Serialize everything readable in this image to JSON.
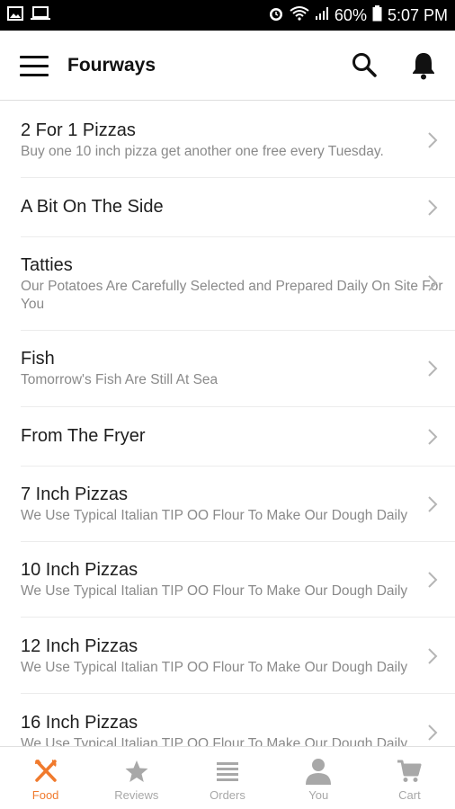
{
  "status_bar": {
    "battery": "60%",
    "time": "5:07 PM",
    "icons": [
      "image-icon",
      "laptop-icon",
      "alarm-icon",
      "wifi-icon",
      "signal-icon",
      "battery-icon"
    ]
  },
  "app_bar": {
    "title": "Fourways",
    "icons": [
      "menu-icon",
      "search-icon",
      "bell-icon"
    ]
  },
  "categories": [
    {
      "title": "2 For 1 Pizzas",
      "description": "Buy one 10 inch pizza get another one free every Tuesday."
    },
    {
      "title": "A Bit On The Side",
      "description": ""
    },
    {
      "title": "Tatties",
      "description": "Our Potatoes Are Carefully Selected and Prepared Daily On Site For You"
    },
    {
      "title": "Fish",
      "description": "Tomorrow's Fish Are Still At Sea"
    },
    {
      "title": "From The Fryer",
      "description": ""
    },
    {
      "title": "7 Inch Pizzas",
      "description": "We Use Typical Italian TIP OO Flour To Make Our Dough Daily"
    },
    {
      "title": "10 Inch Pizzas",
      "description": "We Use Typical Italian TIP OO Flour To Make Our Dough Daily"
    },
    {
      "title": "12 Inch Pizzas",
      "description": "We Use Typical Italian TIP OO Flour To Make Our Dough Daily"
    },
    {
      "title": "16 Inch Pizzas",
      "description": "We Use Typical Italian TIP OO Flour To Make Our Dough Daily"
    }
  ],
  "bottom_nav": [
    {
      "label": "Food",
      "icon": "fork-knife-icon",
      "active": true
    },
    {
      "label": "Reviews",
      "icon": "star-icon",
      "active": false
    },
    {
      "label": "Orders",
      "icon": "list-icon",
      "active": false
    },
    {
      "label": "You",
      "icon": "person-icon",
      "active": false
    },
    {
      "label": "Cart",
      "icon": "cart-icon",
      "active": false
    }
  ],
  "colors": {
    "accent": "#f07a2d",
    "inactive": "#a8a8a8",
    "status_bar": "#000000"
  }
}
